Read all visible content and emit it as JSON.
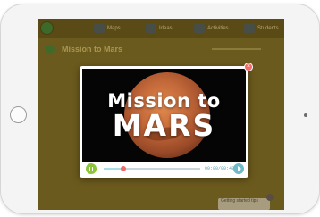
{
  "app": {
    "nav": [
      {
        "label": "Maps"
      },
      {
        "label": "Ideas"
      },
      {
        "label": "Activities"
      },
      {
        "label": "Students"
      }
    ],
    "page_title": "Mission to Mars",
    "tip": {
      "text": "Getting started tips"
    }
  },
  "video": {
    "title_line1": "Mission to",
    "title_line2": "MARS",
    "progress": 0.2,
    "time": "00:00/00:47",
    "close_glyph": "×"
  },
  "colors": {
    "play": "#8cc43c",
    "knob": "#f06a6a",
    "close": "#ee6e6e",
    "overlay": "#6b5a1d"
  },
  "icons": [
    "logo-icon",
    "maps-icon",
    "ideas-icon",
    "activities-icon",
    "students-icon",
    "pause-icon",
    "next-icon",
    "close-icon"
  ]
}
